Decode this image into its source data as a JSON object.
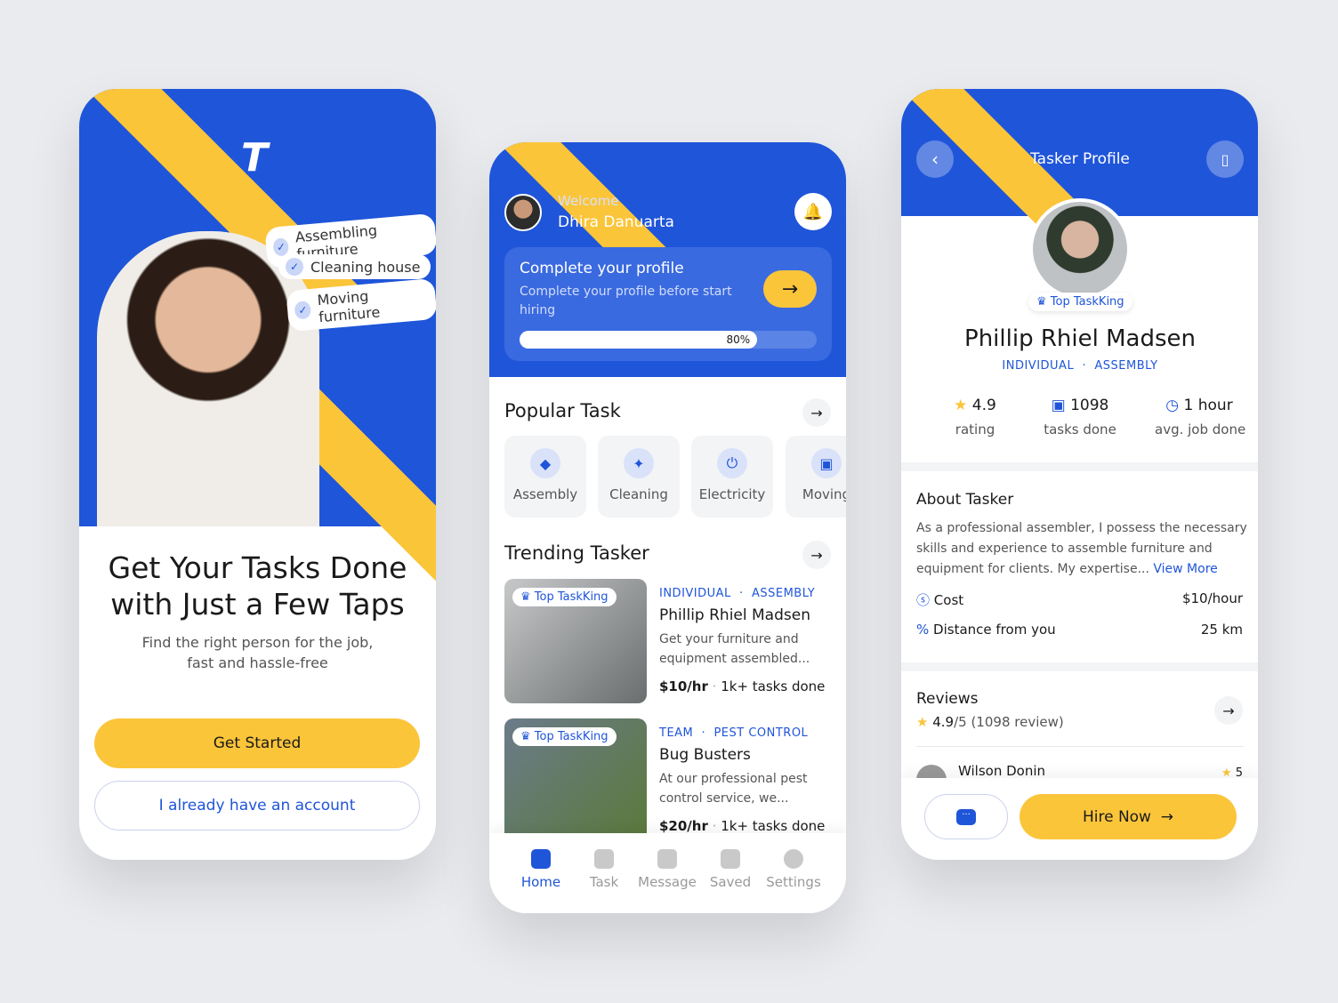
{
  "colors": {
    "primary": "#1f55d9",
    "accent": "#fbc53a",
    "background": "#e9ebef"
  },
  "onboarding": {
    "chips": [
      "Assembling furniture",
      "Cleaning house",
      "Moving furniture"
    ],
    "title_line1": "Get Your Tasks Done",
    "title_line2": "with Just a Few Taps",
    "subtitle_line1": "Find the right person for the job,",
    "subtitle_line2": "fast and hassle-free",
    "get_started": "Get Started",
    "have_account": "I already have an account"
  },
  "home": {
    "welcome": "Welcome",
    "user_name": "Dhira Danuarta",
    "profile_card": {
      "title": "Complete your profile",
      "text": "Complete your profile before start hiring",
      "progress": 80,
      "progress_label": "80%"
    },
    "popular_title": "Popular Task",
    "categories": [
      {
        "label": "Assembly",
        "icon": "cube-icon"
      },
      {
        "label": "Cleaning",
        "icon": "broom-icon"
      },
      {
        "label": "Electricity",
        "icon": "plug-icon"
      },
      {
        "label": "Moving",
        "icon": "box-icon"
      }
    ],
    "trending_title": "Trending Tasker",
    "taskers": [
      {
        "badge": "Top TaskKing",
        "type": "INDIVIDUAL",
        "category": "ASSEMBLY",
        "name": "Phillip Rhiel Madsen",
        "desc_line1": "Get your furniture and",
        "desc_line2": "equipment assembled...",
        "price": "$10/hr",
        "tasks": "1k+ tasks done"
      },
      {
        "badge": "Top TaskKing",
        "type": "TEAM",
        "category": "PEST CONTROL",
        "name": "Bug Busters",
        "desc_line1": "At our professional pest",
        "desc_line2": "control service, we...",
        "price": "$20/hr",
        "tasks": "1k+ tasks done"
      }
    ],
    "nav": [
      {
        "label": "Home",
        "active": true
      },
      {
        "label": "Task"
      },
      {
        "label": "Message"
      },
      {
        "label": "Saved"
      },
      {
        "label": "Settings"
      }
    ]
  },
  "profile": {
    "header_title": "Tasker Profile",
    "badge": "Top TaskKing",
    "name": "Phillip Rhiel Madsen",
    "type": "INDIVIDUAL",
    "category": "ASSEMBLY",
    "stats": [
      {
        "value": "4.9",
        "label": "rating"
      },
      {
        "value": "1098",
        "label": "tasks done"
      },
      {
        "value": "1 hour",
        "label": "avg. job done"
      }
    ],
    "about_title": "About Tasker",
    "about_lines": [
      "As a professional assembler, I possess the necessary",
      "skills and experience to assemble furniture and",
      "equipment for clients. My expertise..."
    ],
    "view_more": "View More",
    "cost_label": "Cost",
    "cost_value": "$10/hour",
    "distance_label": "Distance from you",
    "distance_value": "25 km",
    "reviews_title": "Reviews",
    "reviews_score": "4.9",
    "reviews_rest": "/5 (1098 review)",
    "reviewer": "Wilson Donin",
    "reviewer_rating": "5",
    "hire": "Hire Now"
  }
}
